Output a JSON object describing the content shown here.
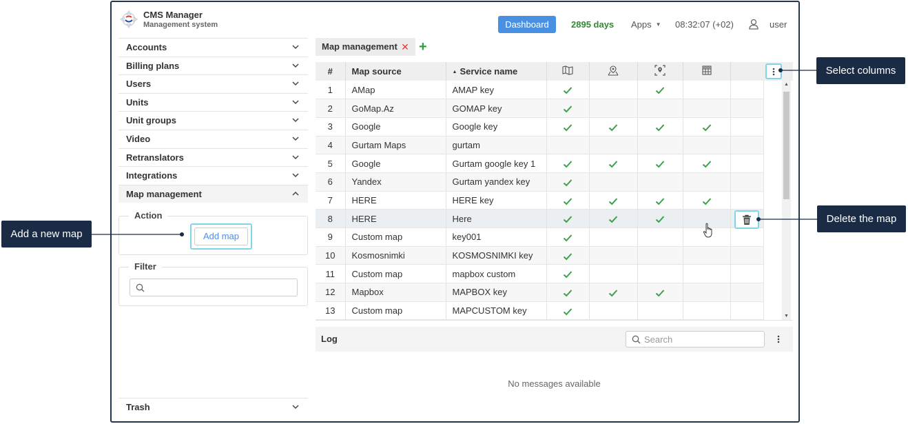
{
  "header": {
    "title": "CMS Manager",
    "subtitle": "Management system",
    "dashboard_label": "Dashboard",
    "days": "2895 days",
    "apps_label": "Apps",
    "clock": "08:32:07 (+02)",
    "user": "user"
  },
  "sidebar": {
    "items": [
      {
        "label": "Accounts"
      },
      {
        "label": "Billing plans"
      },
      {
        "label": "Users"
      },
      {
        "label": "Units"
      },
      {
        "label": "Unit groups"
      },
      {
        "label": "Video"
      },
      {
        "label": "Retranslators"
      },
      {
        "label": "Integrations"
      },
      {
        "label": "Map management"
      }
    ],
    "action_legend": "Action",
    "add_map_label": "Add map",
    "filter_legend": "Filter",
    "filter_value": "",
    "trash_label": "Trash"
  },
  "main": {
    "tab_label": "Map management",
    "table": {
      "headers": {
        "num": "#",
        "source": "Map source",
        "service": "Service name"
      },
      "icon_columns": [
        "map-icon",
        "map-pin-icon",
        "location-target-icon",
        "grid-icon"
      ],
      "rows": [
        {
          "num": "1",
          "source": "AMap",
          "service": "AMAP key",
          "checks": [
            true,
            false,
            true,
            false
          ]
        },
        {
          "num": "2",
          "source": "GoMap.Az",
          "service": "GOMAP key",
          "checks": [
            true,
            false,
            false,
            false
          ]
        },
        {
          "num": "3",
          "source": "Google",
          "service": "Google key",
          "checks": [
            true,
            true,
            true,
            true
          ]
        },
        {
          "num": "4",
          "source": "Gurtam Maps",
          "service": "gurtam",
          "checks": [
            false,
            false,
            false,
            false
          ]
        },
        {
          "num": "5",
          "source": "Google",
          "service": "Gurtam google key 1",
          "checks": [
            true,
            true,
            true,
            true
          ]
        },
        {
          "num": "6",
          "source": "Yandex",
          "service": "Gurtam yandex key",
          "checks": [
            true,
            false,
            false,
            false
          ]
        },
        {
          "num": "7",
          "source": "HERE",
          "service": "HERE key",
          "checks": [
            true,
            true,
            true,
            true
          ]
        },
        {
          "num": "8",
          "source": "HERE",
          "service": "Here",
          "checks": [
            true,
            true,
            true,
            false
          ]
        },
        {
          "num": "9",
          "source": "Custom map",
          "service": "key001",
          "checks": [
            true,
            false,
            false,
            false
          ]
        },
        {
          "num": "10",
          "source": "Kosmosnimki",
          "service": "KOSMOSNIMKI key",
          "checks": [
            true,
            false,
            false,
            false
          ]
        },
        {
          "num": "11",
          "source": "Custom map",
          "service": "mapbox custom",
          "checks": [
            true,
            false,
            false,
            false
          ]
        },
        {
          "num": "12",
          "source": "Mapbox",
          "service": "MAPBOX key",
          "checks": [
            true,
            true,
            true,
            false
          ]
        },
        {
          "num": "13",
          "source": "Custom map",
          "service": "MAPCUSTOM key",
          "checks": [
            true,
            false,
            false,
            false
          ]
        }
      ]
    },
    "log": {
      "title": "Log",
      "search_placeholder": "Search",
      "empty": "No messages available"
    }
  },
  "callouts": {
    "add_map": "Add a new map",
    "select_columns": "Select columns",
    "delete_map": "Delete the map"
  },
  "colors": {
    "accent": "#4a90e2",
    "check": "#3aa04a",
    "days": "#2e8b2e",
    "highlight": "#7fd4ea",
    "callout_bg": "#1a2b45"
  }
}
